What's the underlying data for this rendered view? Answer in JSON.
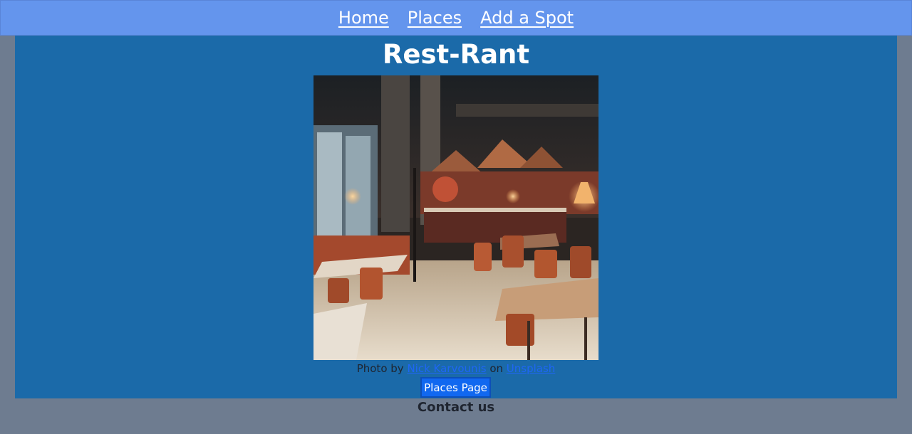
{
  "nav": {
    "items": [
      {
        "label": "Home"
      },
      {
        "label": "Places"
      },
      {
        "label": "Add a Spot"
      }
    ]
  },
  "main": {
    "title": "Rest-Rant",
    "credit": {
      "prefix": "Photo by",
      "author": "Nick Karvounis",
      "middle": "on",
      "source": "Unsplash"
    },
    "places_button": "Places Page"
  },
  "footer": {
    "contact": "Contact us"
  },
  "colors": {
    "nav_bg": "#6495ed",
    "main_bg": "#1b6aa9",
    "page_bg": "#6e7c90",
    "button_bg": "#1168f0"
  }
}
